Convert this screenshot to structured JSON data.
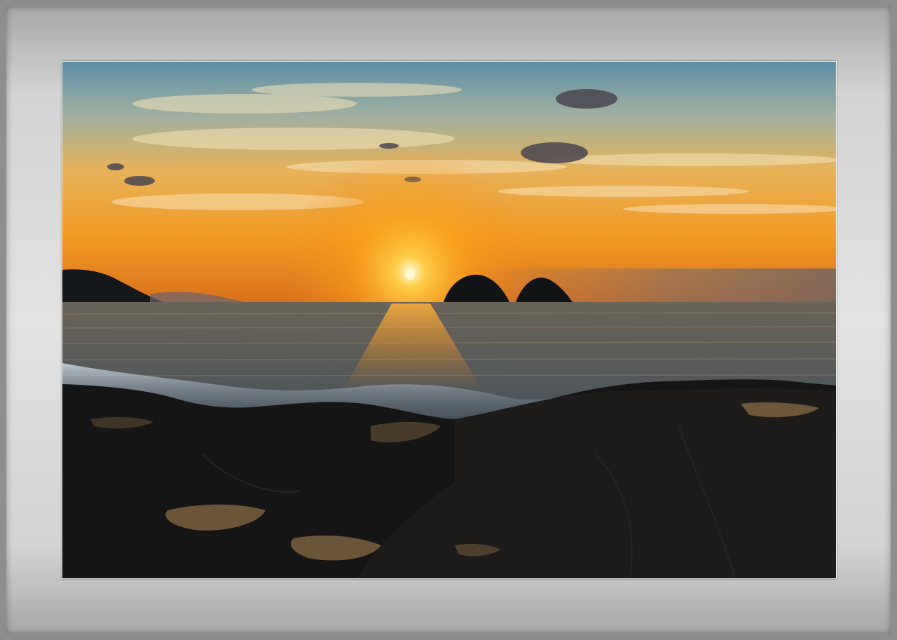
{
  "scene": {
    "subject": "sunset-over-sea",
    "colors": {
      "frame": "#8e8e8e",
      "mat_light": "#e2e2e2",
      "sky_top": "#5f8fa6",
      "sky_mid": "#e9a53c",
      "sky_horizon": "#f08a1c",
      "sun": "#fff6c8",
      "sea": "#3c4a55",
      "rocks": "#141414"
    }
  }
}
